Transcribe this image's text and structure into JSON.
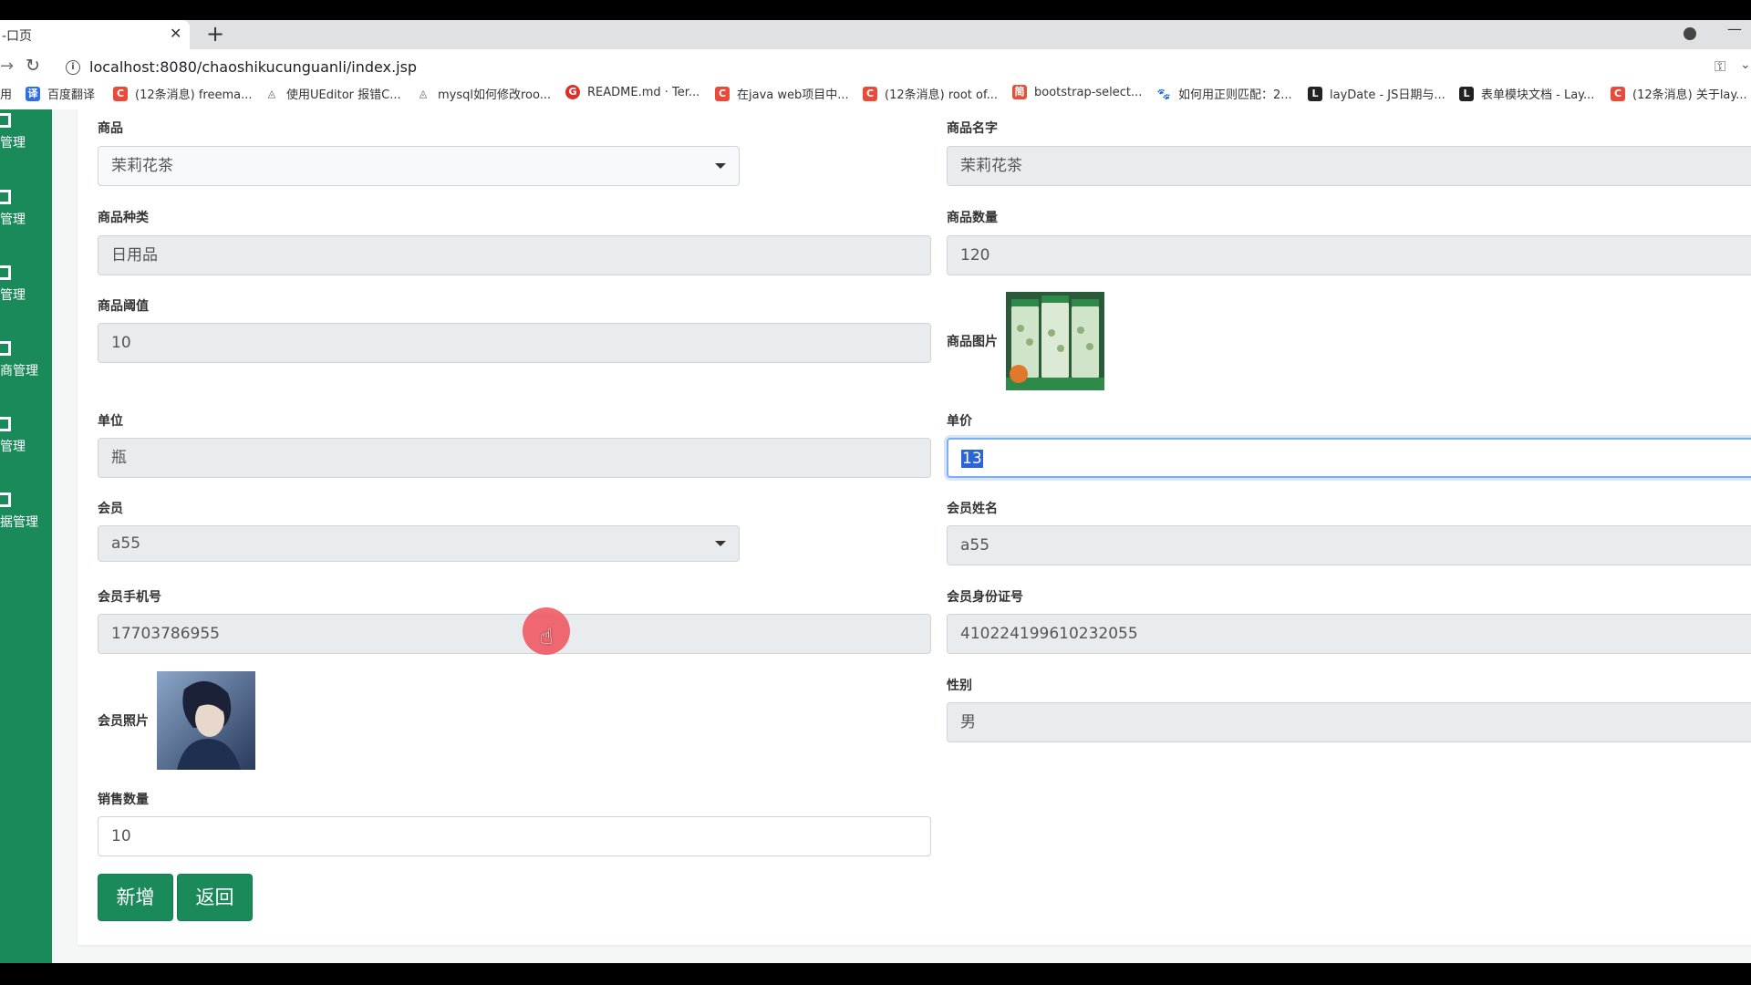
{
  "browser": {
    "tab_title": "-口页",
    "tab_close": "✕",
    "new_tab": "+",
    "url": "localhost:8080/chaoshikucunguanli/index.jsp",
    "bookmarks": [
      {
        "label": "用",
        "icon": "",
        "color": "#ffffff"
      },
      {
        "label": "百度翻译",
        "icon": "译",
        "color": "#2f6fe0"
      },
      {
        "label": "(12条消息) freema...",
        "icon": "C",
        "color": "#e84b3a"
      },
      {
        "label": "使用UEditor 报错C...",
        "icon": "◬",
        "color": "#555555"
      },
      {
        "label": "mysql如何修改roo...",
        "icon": "◬",
        "color": "#555555"
      },
      {
        "label": "README.md · Ter...",
        "icon": "G",
        "color": "#d9322b"
      },
      {
        "label": "在java web项目中...",
        "icon": "C",
        "color": "#e84b3a"
      },
      {
        "label": "(12条消息) root of...",
        "icon": "C",
        "color": "#e84b3a"
      },
      {
        "label": "bootstrap-select...",
        "icon": "简",
        "color": "#e0533b"
      },
      {
        "label": "如何用正则匹配：2...",
        "icon": "🐾",
        "color": "#3366cc"
      },
      {
        "label": "layDate - JS日期与...",
        "icon": "L",
        "color": "#222222"
      },
      {
        "label": "表单模块文档 - Lay...",
        "icon": "L",
        "color": "#222222"
      },
      {
        "label": "(12条消息) 关于lay...",
        "icon": "C",
        "color": "#e84b3a"
      }
    ]
  },
  "sidebar": {
    "items": [
      {
        "label": "管理"
      },
      {
        "label": "管理"
      },
      {
        "label": "管理"
      },
      {
        "label": "商管理"
      },
      {
        "label": "管理"
      },
      {
        "label": "据管理"
      }
    ]
  },
  "form": {
    "product": {
      "label": "商品",
      "value": "茉莉花茶"
    },
    "product_name": {
      "label": "商品名字",
      "value": "茉莉花茶"
    },
    "category": {
      "label": "商品种类",
      "value": "日用品"
    },
    "quantity": {
      "label": "商品数量",
      "value": "120"
    },
    "threshold": {
      "label": "商品阈值",
      "value": "10"
    },
    "product_image": {
      "label": "商品图片"
    },
    "unit": {
      "label": "单位",
      "value": "瓶"
    },
    "unit_price": {
      "label": "单价",
      "value": "13"
    },
    "member": {
      "label": "会员",
      "value": "a55"
    },
    "member_name": {
      "label": "会员姓名",
      "value": "a55"
    },
    "member_phone": {
      "label": "会员手机号",
      "value": "17703786955"
    },
    "member_id": {
      "label": "会员身份证号",
      "value": "410224199610232055"
    },
    "member_photo": {
      "label": "会员照片"
    },
    "gender": {
      "label": "性别",
      "value": "男"
    },
    "sale_quantity": {
      "label": "销售数量",
      "value": "10"
    }
  },
  "buttons": {
    "add": "新增",
    "back": "返回"
  },
  "colors": {
    "brand": "#1b8a5a",
    "focus": "#7aaef5"
  }
}
